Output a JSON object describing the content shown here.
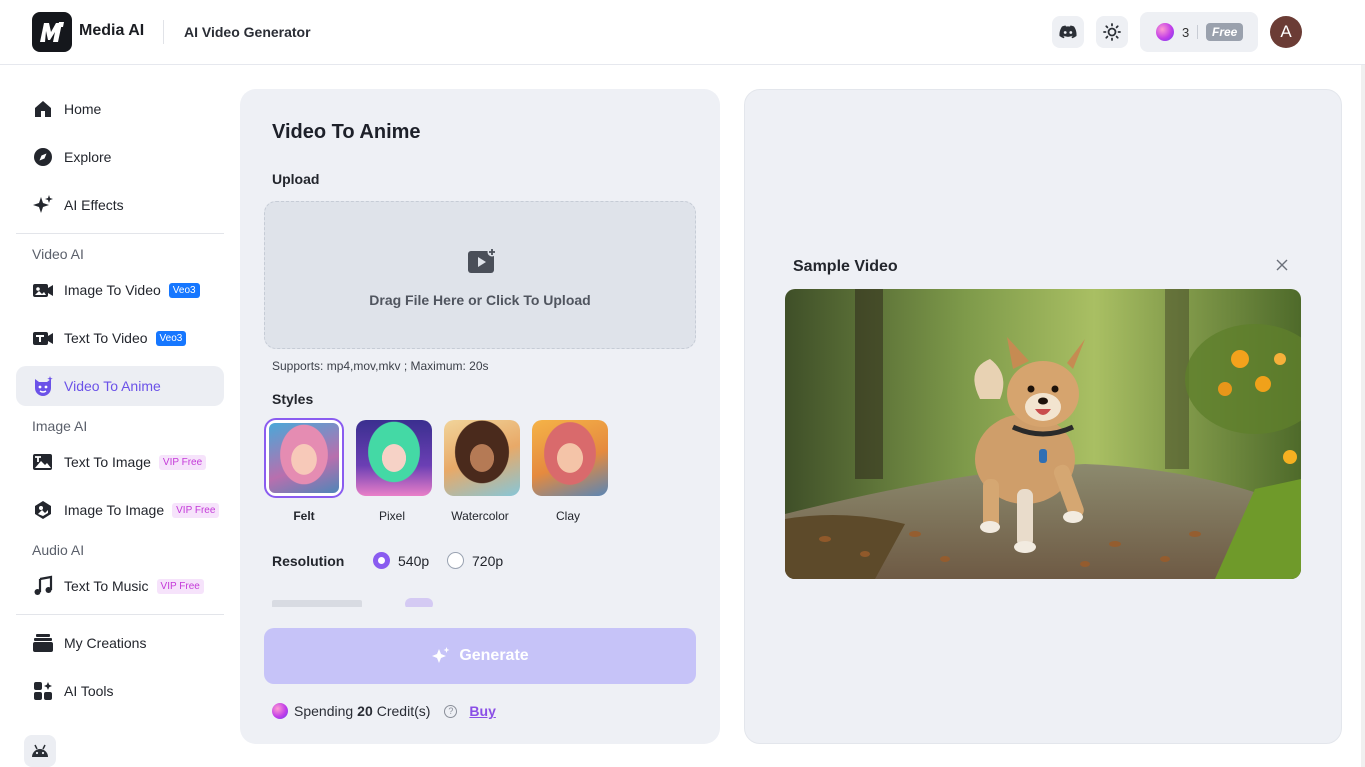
{
  "header": {
    "brand": "Media AI",
    "title": "AI Video Generator",
    "credits": "3",
    "plan": "Free",
    "avatar_letter": "A"
  },
  "sidebar": {
    "items_top": [
      {
        "label": "Home",
        "icon": "home-icon"
      },
      {
        "label": "Explore",
        "icon": "compass-icon"
      },
      {
        "label": "AI Effects",
        "icon": "sparkle-icon"
      }
    ],
    "video_section": "Video AI",
    "video_items": [
      {
        "label": "Image To Video",
        "badge": "Veo3"
      },
      {
        "label": "Text To Video",
        "badge": "Veo3"
      },
      {
        "label": "Video To Anime",
        "badge": ""
      }
    ],
    "image_section": "Image AI",
    "image_items": [
      {
        "label": "Text To Image",
        "badge": "VIP Free"
      },
      {
        "label": "Image To Image",
        "badge": "VIP Free"
      }
    ],
    "audio_section": "Audio AI",
    "audio_items": [
      {
        "label": "Text To Music",
        "badge": "VIP Free"
      }
    ],
    "bottom_items": [
      {
        "label": "My Creations"
      },
      {
        "label": "AI Tools"
      }
    ]
  },
  "form": {
    "title": "Video To Anime",
    "upload_label": "Upload",
    "upload_text": "Drag File Here or Click To Upload",
    "supports": "Supports: mp4,mov,mkv ; Maximum: 20s",
    "styles_label": "Styles",
    "styles": [
      {
        "name": "Felt",
        "selected": true
      },
      {
        "name": "Pixel",
        "selected": false
      },
      {
        "name": "Watercolor",
        "selected": false
      },
      {
        "name": "Clay",
        "selected": false
      }
    ],
    "resolution_label": "Resolution",
    "resolutions": [
      "540p",
      "720p"
    ],
    "selected_resolution": "540p",
    "generate_label": "Generate",
    "spending_prefix": "Spending",
    "spending_amount": "20",
    "spending_suffix": "Credit(s)",
    "buy_label": "Buy"
  },
  "preview": {
    "title": "Sample Video"
  },
  "colors": {
    "accent": "#8a5cf0",
    "generate_bg": "#c6c3f8",
    "veo_badge": "#1677ff",
    "vip_badge_text": "#c43ad8"
  }
}
